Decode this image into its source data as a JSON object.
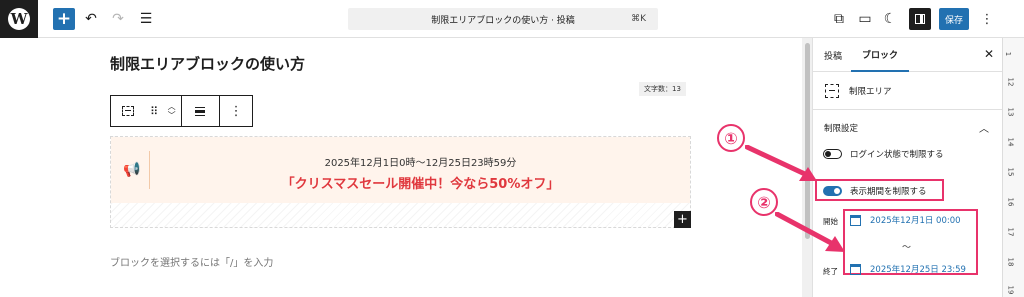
{
  "topbar": {
    "add_icon": "plus-icon",
    "command_bar_text": "制限エリアブロックの使い方 · 投稿",
    "command_shortcut": "⌘K",
    "save_label": "保存"
  },
  "editor": {
    "post_title": "制限エリアブロックの使い方",
    "word_count": "文字数：13",
    "notice": {
      "period_text": "2025年12月1日0時〜12月25日23時59分",
      "message": "「クリスマスセール開催中！今なら50%オフ」",
      "icon": "megaphone-icon"
    },
    "append_hint": "ブロックを選択するには「/」を入力"
  },
  "sidebar": {
    "tabs": [
      "投稿",
      "ブロック"
    ],
    "active_tab": "ブロック",
    "block_name": "制限エリア",
    "panel_title": "制限設定",
    "login_toggle": {
      "label": "ログイン状態で制限する",
      "checked": false
    },
    "period_toggle": {
      "label": "表示期間を制限する",
      "checked": true
    },
    "start_label": "開始",
    "start_value": "2025年12月1日 00:00",
    "separator": "〜",
    "end_label": "終了",
    "end_value": "2025年12月25日 23:59"
  },
  "ruler": {
    "numbers": [
      "1",
      "12",
      "13",
      "14",
      "15",
      "16",
      "17",
      "18",
      "19"
    ]
  },
  "annotations": {
    "one": "①",
    "two": "②",
    "color": "#e8336b"
  },
  "colors": {
    "accent": "#2271b1",
    "notice_bg": "#fff4ec",
    "notice_text": "#e0383e",
    "annotation": "#e8336b"
  }
}
